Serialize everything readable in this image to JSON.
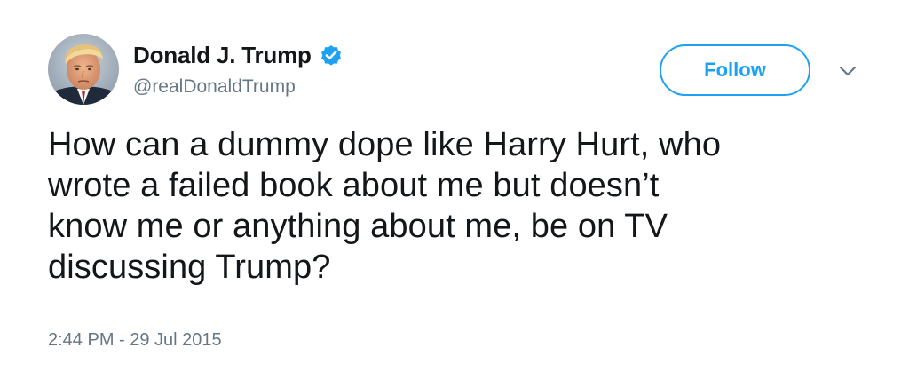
{
  "author": {
    "display_name": "Donald J. Trump",
    "handle": "@realDonaldTrump",
    "verified": true,
    "avatar_icon": "profile-photo-avatar"
  },
  "actions": {
    "follow_label": "Follow",
    "menu_icon": "chevron-down-icon"
  },
  "tweet": {
    "lines": [
      "How can a dummy dope like Harry Hurt, who",
      "wrote a failed book about me but doesn’t",
      "know me or anything about me, be on TV",
      "discussing Trump?"
    ],
    "timestamp": "2:44 PM - 29 Jul 2015"
  },
  "colors": {
    "accent": "#1da1f2",
    "text": "#14171a",
    "secondary_text": "#657786",
    "background": "#ffffff"
  }
}
